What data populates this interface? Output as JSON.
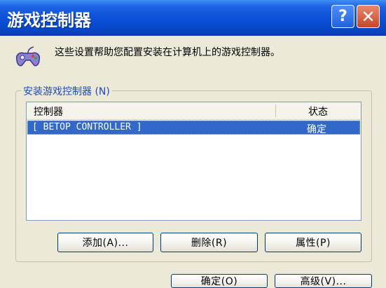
{
  "window": {
    "title": "游戏控制器",
    "help_label": "?",
    "close_label": "✕"
  },
  "intro_text": "这些设置帮助您配置安装在计算机上的游戏控制器。",
  "group": {
    "title": "安装游戏控制器 (N)",
    "columns": {
      "name": "控制器",
      "status": "状态"
    },
    "rows": [
      {
        "name": "[ BETOP CONTROLLER ]",
        "status": "确定",
        "selected": true
      }
    ]
  },
  "buttons": {
    "add": "添加(A)...",
    "remove": "删除(R)",
    "properties": "属性(P)",
    "ok": "确定(O)",
    "advanced": "高级(V)..."
  },
  "icons": {
    "app": "gamepad-icon"
  }
}
